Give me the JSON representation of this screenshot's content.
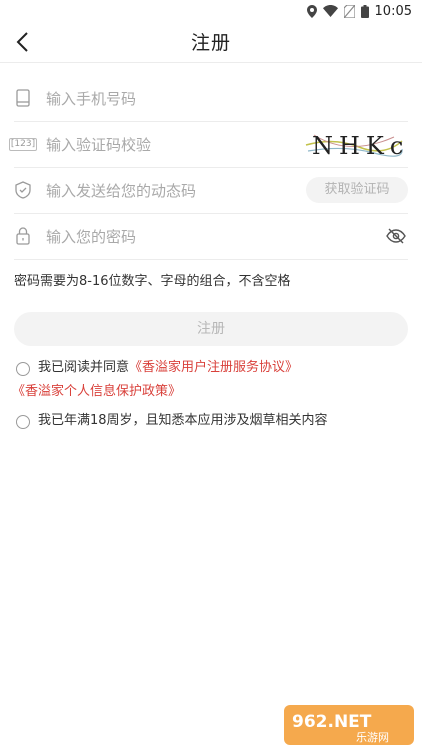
{
  "status_bar": {
    "time": "10:05"
  },
  "nav": {
    "title": "注册"
  },
  "form": {
    "phone_placeholder": "输入手机号码",
    "captcha_placeholder": "输入验证码校验",
    "captcha_icon_text": "[123]",
    "captcha_text": "NHKc",
    "sms_placeholder": "输入发送给您的动态码",
    "get_code_label": "获取验证码",
    "password_placeholder": "输入您的密码"
  },
  "password_hint": "密码需要为8-16位数字、字母的组合，不含空格",
  "submit_label": "注册",
  "agreements": {
    "prefix": "我已阅读并同意",
    "user_agreement": "《香溢家用户注册服务协议》",
    "privacy_policy": "《香溢家个人信息保护政策》",
    "age_statement": "我已年满18周岁，且知悉本应用涉及烟草相关内容"
  },
  "watermark": {
    "brand": "962.NET",
    "sub": "乐游网"
  },
  "colors": {
    "link": "#d9413b",
    "disabled_bg": "#f3f3f3"
  }
}
